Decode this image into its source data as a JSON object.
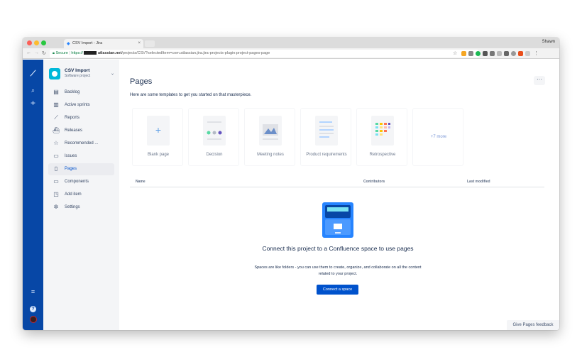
{
  "browser": {
    "tab_title": "CSV Import - Jira",
    "tab_close": "×",
    "profile_name": "Shawn",
    "secure_label": "Secure",
    "url_protocol": "https://",
    "url_host": "atlassian.net",
    "url_path": "/projects/CSV?selectedItem=com.atlassian.jira.jira-projects-plugin:project-pages-page"
  },
  "project": {
    "name": "CSV Import",
    "type": "Software project"
  },
  "sidebar": {
    "items": [
      {
        "label": "Backlog",
        "icon": "backlog-icon"
      },
      {
        "label": "Active sprints",
        "icon": "board-icon"
      },
      {
        "label": "Reports",
        "icon": "chart-icon"
      },
      {
        "label": "Releases",
        "icon": "ship-icon"
      },
      {
        "label": "Recommended ...",
        "icon": "star-icon"
      },
      {
        "label": "Issues",
        "icon": "issues-icon"
      },
      {
        "label": "Pages",
        "icon": "page-icon",
        "active": true
      },
      {
        "label": "Components",
        "icon": "component-icon"
      },
      {
        "label": "Add item",
        "icon": "add-item-icon"
      },
      {
        "label": "Settings",
        "icon": "gear-icon"
      }
    ]
  },
  "main": {
    "title": "Pages",
    "more_label": "···",
    "intro": "Here are some templates to get you started on that masterpiece.",
    "templates": [
      {
        "label": "Blank page"
      },
      {
        "label": "Decision"
      },
      {
        "label": "Meeting notes"
      },
      {
        "label": "Product requirements"
      },
      {
        "label": "Retrospective"
      },
      {
        "label": "+7 more"
      }
    ],
    "table": {
      "col_name": "Name",
      "col_contributors": "Contributors",
      "col_modified": "Last modified"
    },
    "empty": {
      "title": "Connect this project to a Confluence space to use pages",
      "description": "Spaces are like folders - you can use them to create, organize, and collaborate on all the content related to your project.",
      "button": "Connect a space"
    },
    "feedback": "Give Pages feedback"
  },
  "colors": {
    "global_nav": "#0747a6",
    "primary": "#0052cc",
    "sidebar_bg": "#f4f5f7"
  }
}
